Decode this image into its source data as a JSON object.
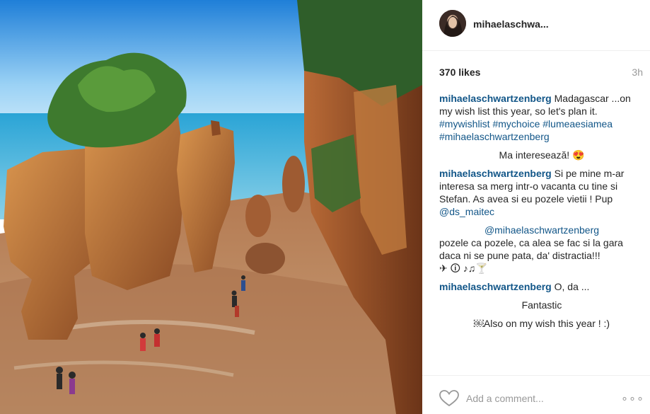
{
  "post": {
    "username": "mihaelaschwa...",
    "likes": "370 likes",
    "time": "3h",
    "photo": {
      "subject": "sea-stacks-rock-formations-on-beach"
    }
  },
  "comments": [
    {
      "author": "mihaelaschwartzenberg",
      "text": "Madagascar ...on my wish list this year, so let's plan it.",
      "hashtags": "#mywishlist #mychoice #lumeaesiamea #mihaelaschwartzenberg"
    },
    {
      "text": "Ma interesează! 😍"
    },
    {
      "author": "mihaelaschwartzenberg",
      "text": "Si pe mine m-ar interesa sa merg intr-o vacanta cu tine si Stefan. As avea si eu pozele vietii ! Pup",
      "mention": "@ds_maitec"
    },
    {
      "mention": "@mihaelaschwartzenberg",
      "text": "pozele ca pozele, ca alea se fac si la gara daca ni se pune pata, da' distractia!!!",
      "emoji": "✈ 🛈 ♪♫🍸"
    },
    {
      "author": "mihaelaschwartzenberg",
      "text": "O, da ..."
    },
    {
      "text": "Fantastic"
    },
    {
      "text": "￼Also on my wish this year ! :)"
    }
  ],
  "footer": {
    "placeholder": "Add a comment...",
    "more": "∘∘∘"
  },
  "icons": {
    "like": "heart-outline-icon",
    "more": "more-options-icon"
  },
  "colors": {
    "link": "#125688",
    "muted": "#999999",
    "border": "#efefef"
  }
}
